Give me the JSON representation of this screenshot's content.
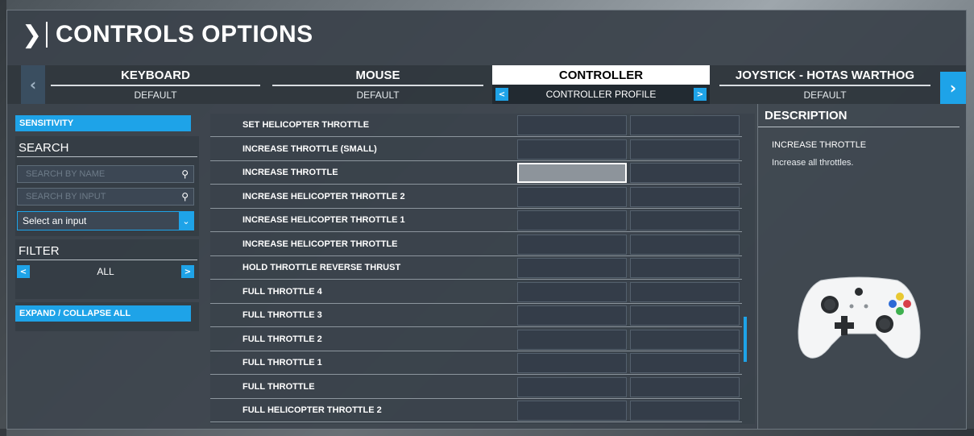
{
  "title": "CONTROLS OPTIONS",
  "tabs": [
    {
      "name": "KEYBOARD",
      "profile": "DEFAULT"
    },
    {
      "name": "MOUSE",
      "profile": "DEFAULT"
    },
    {
      "name": "CONTROLLER",
      "profile": "CONTROLLER PROFILE"
    },
    {
      "name": "JOYSTICK - HOTAS WARTHOG",
      "profile": "DEFAULT"
    }
  ],
  "left_panel": {
    "sensitivity_label": "SENSITIVITY",
    "search_title": "SEARCH",
    "search_by_name_placeholder": "SEARCH BY NAME",
    "search_by_input_placeholder": "SEARCH BY INPUT",
    "select_input_value": "Select an input",
    "filter_title": "FILTER",
    "filter_value": "ALL",
    "expand_collapse_label": "EXPAND / COLLAPSE ALL"
  },
  "list": {
    "rows": [
      "SET HELICOPTER THROTTLE",
      "INCREASE THROTTLE (SMALL)",
      "INCREASE THROTTLE",
      "INCREASE HELICOPTER THROTTLE 2",
      "INCREASE HELICOPTER THROTTLE 1",
      "INCREASE HELICOPTER THROTTLE",
      "HOLD THROTTLE REVERSE THRUST",
      "FULL THROTTLE 4",
      "FULL THROTTLE 3",
      "FULL THROTTLE 2",
      "FULL THROTTLE 1",
      "FULL THROTTLE",
      "FULL HELICOPTER THROTTLE 2"
    ],
    "selected_index": 2
  },
  "description": {
    "title": "DESCRIPTION",
    "name": "INCREASE THROTTLE",
    "text": "Increase all throttles."
  },
  "colors": {
    "accent": "#1ea3e8",
    "panel": "#3a424a"
  },
  "icons": {
    "title_chevron": "chevron-right-icon",
    "search": "search-icon",
    "controller": "xbox-controller-icon"
  }
}
